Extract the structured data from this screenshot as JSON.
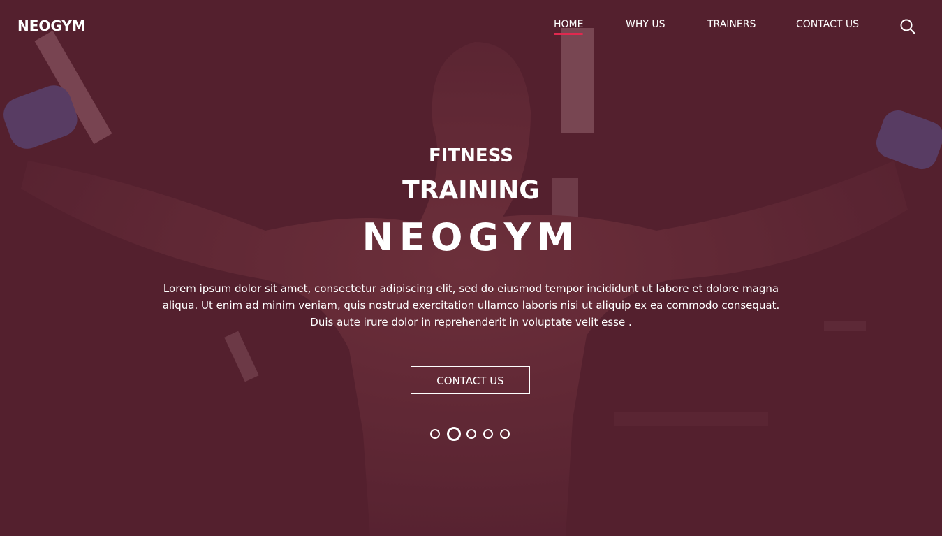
{
  "brand": {
    "logo_text": "NEOGYM"
  },
  "nav": {
    "items": [
      {
        "label": "HOME",
        "active": true
      },
      {
        "label": "WHY US",
        "active": false
      },
      {
        "label": "TRAINERS",
        "active": false
      },
      {
        "label": "CONTACT US",
        "active": false
      }
    ],
    "search_icon": "search-icon"
  },
  "hero": {
    "line1": "FITNESS",
    "line2": "TRAINING",
    "line3": "NEOGYM",
    "description": "Lorem ipsum dolor sit amet, consectetur adipiscing elit, sed do eiusmod tempor incididunt ut labore et dolore magna aliqua. Ut enim ad minim veniam, quis nostrud exercitation ullamco laboris nisi ut aliquip ex ea commodo consequat. Duis aute irure dolor in reprehenderit in voluptate velit esse .",
    "cta_label": "CONTACT US"
  },
  "slider": {
    "slide_count": 5,
    "active_index": 1
  },
  "colors": {
    "overlay": "#521e2f",
    "accent": "#e0294f",
    "text": "#ffffff"
  }
}
